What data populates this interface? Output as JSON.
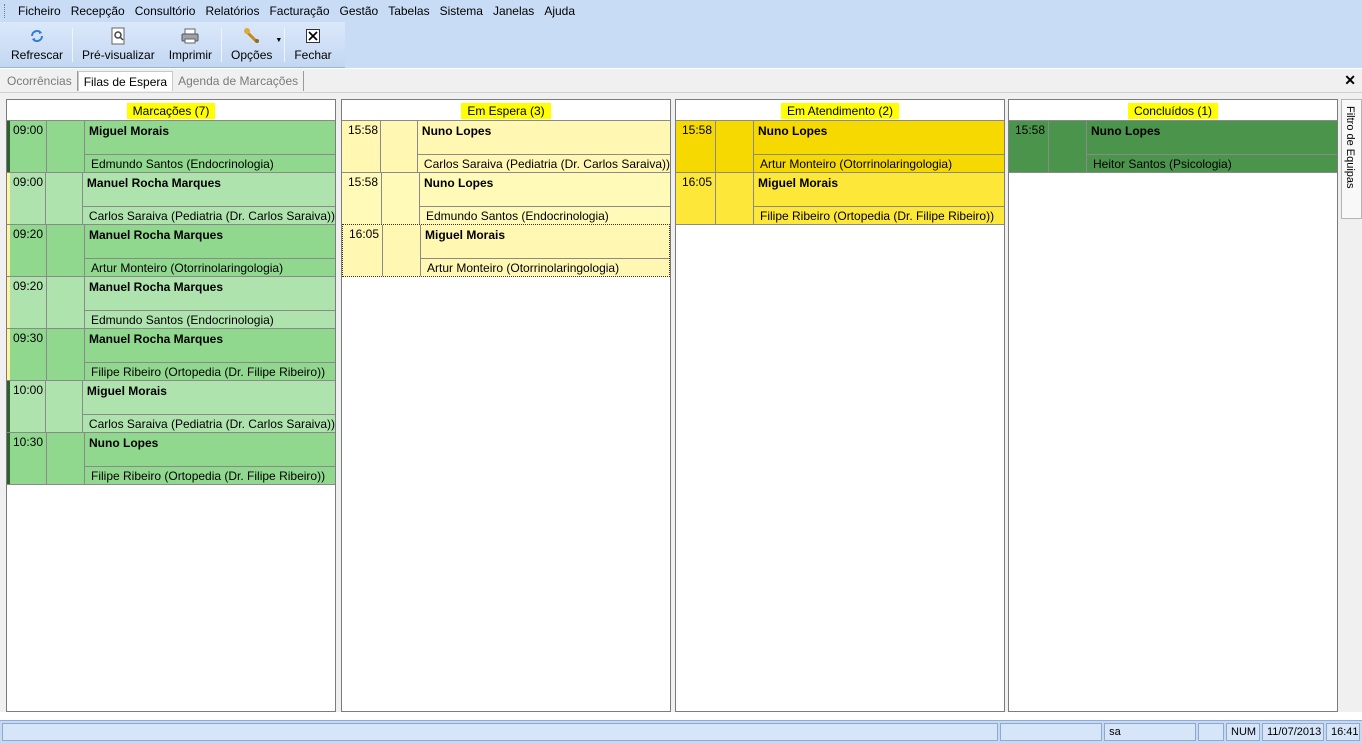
{
  "menu": [
    "Ficheiro",
    "Recepção",
    "Consultório",
    "Relatórios",
    "Facturação",
    "Gestão",
    "Tabelas",
    "Sistema",
    "Janelas",
    "Ajuda"
  ],
  "toolbar": {
    "refresh": "Refrescar",
    "preview": "Pré-visualizar",
    "print": "Imprimir",
    "options": "Opções",
    "close": "Fechar"
  },
  "tabs": [
    "Ocorrências",
    "Filas de Espera",
    "Agenda de Marcações"
  ],
  "columns": [
    {
      "title": "Marcações (7)",
      "cards": [
        {
          "time": "09:00",
          "name": "Miguel Morais",
          "desc": "Edmundo Santos (Endocrinologia)"
        },
        {
          "time": "09:00",
          "name": "Manuel Rocha Marques",
          "desc": "Carlos Saraiva (Pediatria (Dr. Carlos Saraiva))"
        },
        {
          "time": "09:20",
          "name": "Manuel Rocha Marques",
          "desc": "Artur Monteiro (Otorrinolaringologia)"
        },
        {
          "time": "09:20",
          "name": "Manuel Rocha Marques",
          "desc": "Edmundo Santos (Endocrinologia)"
        },
        {
          "time": "09:30",
          "name": "Manuel Rocha Marques",
          "desc": "Filipe Ribeiro (Ortopedia (Dr. Filipe Ribeiro))"
        },
        {
          "time": "10:00",
          "name": "Miguel Morais",
          "desc": "Carlos Saraiva (Pediatria (Dr. Carlos Saraiva))"
        },
        {
          "time": "10:30",
          "name": "Nuno Lopes",
          "desc": "Filipe Ribeiro (Ortopedia (Dr. Filipe Ribeiro))"
        }
      ]
    },
    {
      "title": "Em Espera (3)",
      "cards": [
        {
          "time": "15:58",
          "name": "Nuno Lopes",
          "desc": "Carlos Saraiva (Pediatria (Dr. Carlos Saraiva))"
        },
        {
          "time": "15:58",
          "name": "Nuno Lopes",
          "desc": "Edmundo Santos (Endocrinologia)"
        },
        {
          "time": "16:05",
          "name": "Miguel Morais",
          "desc": "Artur Monteiro (Otorrinolaringologia)"
        }
      ]
    },
    {
      "title": "Em Atendimento (2)",
      "cards": [
        {
          "time": "15:58",
          "name": "Nuno Lopes",
          "desc": "Artur Monteiro (Otorrinolaringologia)"
        },
        {
          "time": "16:05",
          "name": "Miguel Morais",
          "desc": "Filipe Ribeiro (Ortopedia (Dr. Filipe Ribeiro))"
        }
      ]
    },
    {
      "title": "Concluídos (1)",
      "cards": [
        {
          "time": "15:58",
          "name": "Nuno Lopes",
          "desc": "Heitor Santos (Psicologia)"
        }
      ]
    }
  ],
  "side_panel": "Filtro de Equipas",
  "status": {
    "user": "sa",
    "num": "NUM",
    "date": "11/07/2013",
    "time": "16:41"
  },
  "colors": {
    "menu_bg": "#c9dcf5",
    "highlight": "#ffff00"
  }
}
